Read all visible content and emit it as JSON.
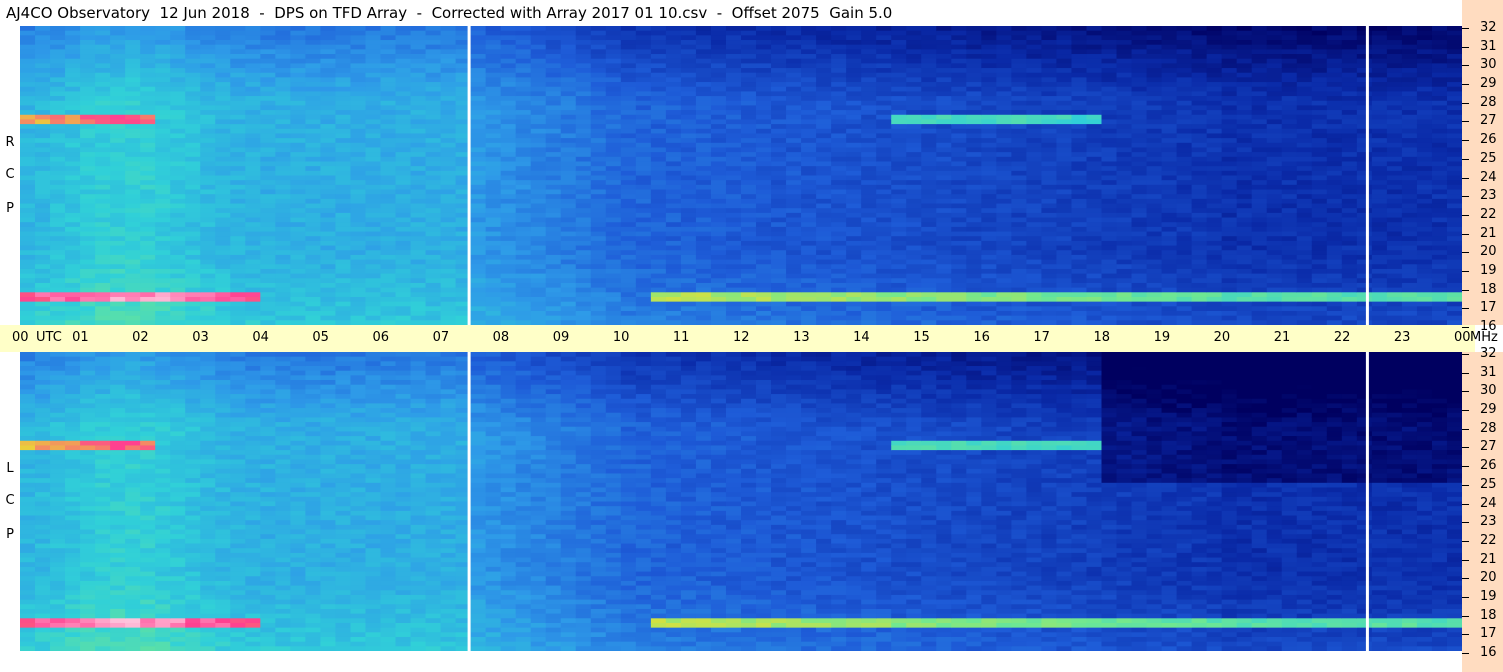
{
  "title": "AJ4CO Observatory  12 Jun 2018  -  DPS on TFD Array  -  Corrected with Array 2017 01 10.csv  -  Offset 2075  Gain 5.0",
  "panels": {
    "rcp_letters": [
      "R",
      "C",
      "P"
    ],
    "lcp_letters": [
      "L",
      "C",
      "P"
    ]
  },
  "time_axis": {
    "first": "00",
    "unit": "UTC",
    "labels": [
      "01",
      "02",
      "03",
      "04",
      "05",
      "06",
      "07",
      "08",
      "09",
      "10",
      "11",
      "12",
      "13",
      "14",
      "15",
      "16",
      "17",
      "18",
      "19",
      "20",
      "21",
      "22",
      "23",
      "00"
    ],
    "freq_unit": "MHz"
  },
  "chart_data": {
    "type": "heatmap",
    "title": "AJ4CO Observatory  12 Jun 2018  -  DPS on TFD Array  -  Corrected with Array 2017 01 10.csv  -  Offset 2075  Gain 5.0",
    "x": {
      "unit": "UTC",
      "range_hours": [
        0,
        24
      ],
      "tick_labels": [
        "00",
        "01",
        "02",
        "03",
        "04",
        "05",
        "06",
        "07",
        "08",
        "09",
        "10",
        "11",
        "12",
        "13",
        "14",
        "15",
        "16",
        "17",
        "18",
        "19",
        "20",
        "21",
        "22",
        "23",
        "00"
      ]
    },
    "y": {
      "unit": "MHz",
      "range": [
        16,
        32
      ],
      "tick_labels": [
        "16",
        "17",
        "18",
        "19",
        "20",
        "21",
        "22",
        "23",
        "24",
        "25",
        "26",
        "27",
        "28",
        "29",
        "30",
        "31",
        "32"
      ]
    },
    "series": [
      {
        "name": "RCP"
      },
      {
        "name": "LCP"
      }
    ],
    "colormap": [
      "#000060",
      "#0a2aa8",
      "#1e5cd8",
      "#2e9ae8",
      "#30d0d8",
      "#70e890",
      "#e8e030",
      "#ff4090",
      "#ffffff"
    ],
    "gaps_utc": [
      7.45,
      22.4
    ]
  }
}
